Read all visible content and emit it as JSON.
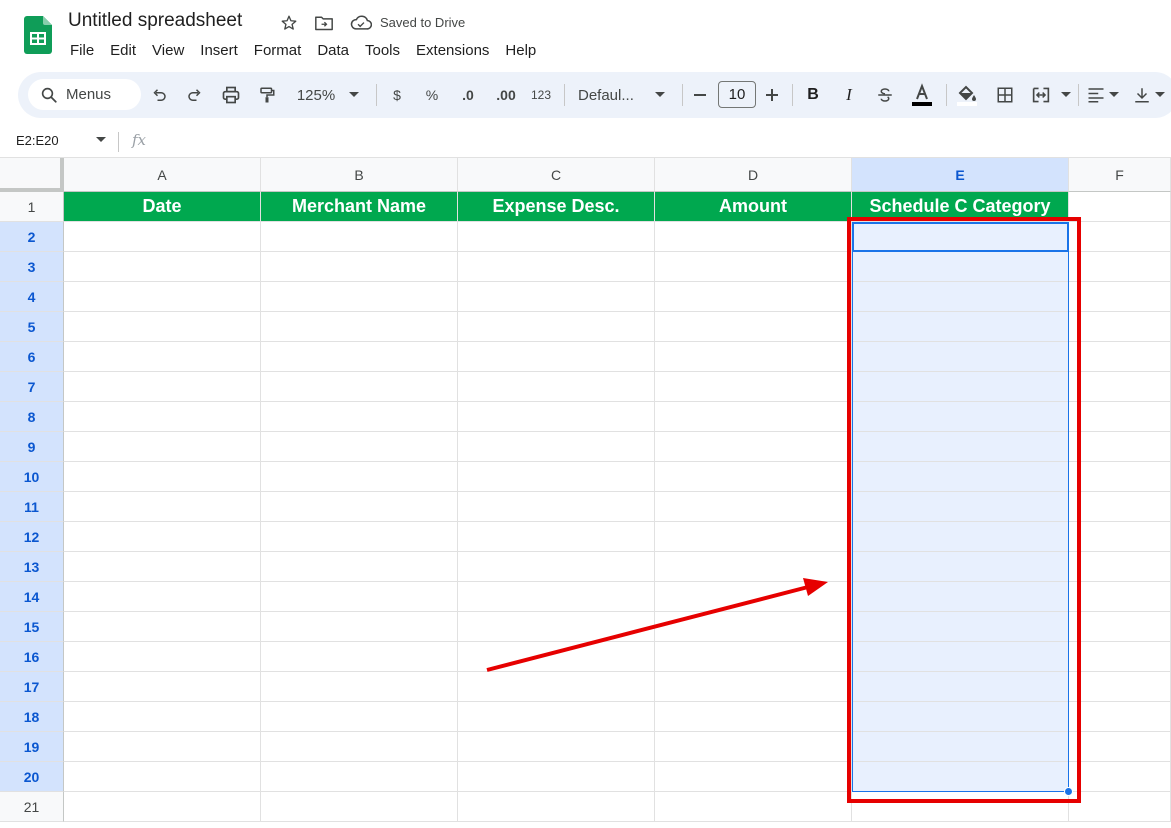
{
  "app": {
    "title": "Untitled spreadsheet",
    "save_status": "Saved to Drive"
  },
  "menu": [
    "File",
    "Edit",
    "View",
    "Insert",
    "Format",
    "Data",
    "Tools",
    "Extensions",
    "Help"
  ],
  "toolbar": {
    "search_label": "Menus",
    "zoom": "125%",
    "currency": "$",
    "percent": "%",
    "decrease_decimal": ".0",
    "increase_decimal": ".00",
    "number_format": "123",
    "font_family": "Defaul...",
    "font_size": "10",
    "bold": "B",
    "italic": "I"
  },
  "formula_bar": {
    "name_box": "E2:E20",
    "fx": "fx"
  },
  "columns": [
    "A",
    "B",
    "C",
    "D",
    "E",
    "F"
  ],
  "rows": [
    "1",
    "2",
    "3",
    "4",
    "5",
    "6",
    "7",
    "8",
    "9",
    "10",
    "11",
    "12",
    "13",
    "14",
    "15",
    "16",
    "17",
    "18",
    "19",
    "20",
    "21"
  ],
  "header_row": [
    "Date",
    "Merchant Name",
    "Expense Desc.",
    "Amount",
    "Schedule C Category"
  ],
  "colors": {
    "header_fill": "#00a84f",
    "selection_fill": "#e8f0fe",
    "selection_border": "#1a73e8",
    "annotation": "#e60000"
  }
}
